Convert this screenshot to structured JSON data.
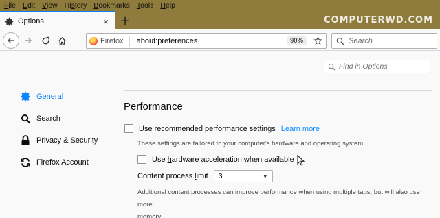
{
  "menu": [
    {
      "pre": "",
      "u": "F",
      "post": "ile"
    },
    {
      "pre": "",
      "u": "E",
      "post": "dit"
    },
    {
      "pre": "",
      "u": "V",
      "post": "iew"
    },
    {
      "pre": "Hi",
      "u": "s",
      "post": "tory"
    },
    {
      "pre": "",
      "u": "B",
      "post": "ookmarks"
    },
    {
      "pre": "",
      "u": "T",
      "post": "ools"
    },
    {
      "pre": "",
      "u": "H",
      "post": "elp"
    }
  ],
  "watermark": "COMPUTERWD.COM",
  "tab": {
    "title": "Options",
    "icon": "gear-icon",
    "close": "×"
  },
  "new_tab": "+",
  "urlbar": {
    "identity": "Firefox",
    "url": "about:preferences",
    "zoom": "90%"
  },
  "searchbar": {
    "placeholder": "Search"
  },
  "find": {
    "placeholder": "Find in Options"
  },
  "sidebar": {
    "items": [
      {
        "label": "General",
        "icon": "gear-icon",
        "selected": true
      },
      {
        "label": "Search",
        "icon": "search-icon",
        "selected": false
      },
      {
        "label": "Privacy & Security",
        "icon": "lock-icon",
        "selected": false
      },
      {
        "label": "Firefox Account",
        "icon": "sync-icon",
        "selected": false
      }
    ]
  },
  "performance": {
    "title": "Performance",
    "recommended_pre": "",
    "recommended_u": "U",
    "recommended_post": "se recommended performance settings",
    "recommended_checked": false,
    "learn_more": "Learn more",
    "recommended_desc": "These settings are tailored to your computer's hardware and operating system.",
    "hw_pre": "Use ",
    "hw_u": "h",
    "hw_post": "ardware acceleration when available",
    "hw_checked": false,
    "limit_pre": "Content process ",
    "limit_u": "l",
    "limit_post": "imit",
    "limit_value": "3",
    "limit_desc_line1": "Additional content processes can improve performance when using multiple tabs, but will also use more",
    "limit_desc_line2": "memory."
  },
  "colors": {
    "accent": "#0a84ff",
    "titlebar": "#8f7b3b",
    "link": "#0a8dff"
  }
}
